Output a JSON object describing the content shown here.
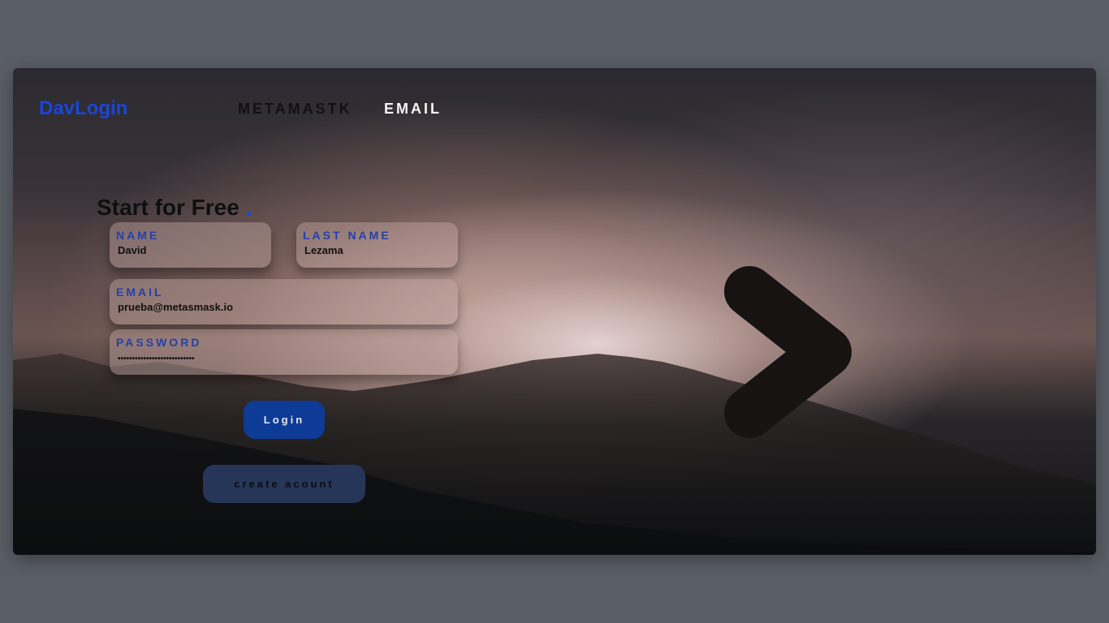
{
  "nav": {
    "brand": "DavLogin",
    "links": [
      {
        "label": "METAMASTK"
      },
      {
        "label": "EMAIL"
      }
    ]
  },
  "form": {
    "heading": "Start for Free",
    "heading_dot": ".",
    "name": {
      "label": "NAME",
      "value": "David"
    },
    "last_name": {
      "label": "LAST NAME",
      "value": "Lezama"
    },
    "email": {
      "label": "EMAIL",
      "value": "prueba@metasmask.io"
    },
    "password": {
      "label": "PASSWORD",
      "value": "•••••••••••••••••••••••••••"
    },
    "login_label": "Login",
    "create_label": "create acount"
  },
  "icons": {
    "next": "chevron-right-icon"
  },
  "colors": {
    "accent": "#1a46d6",
    "label": "#2540a8",
    "login_button": "#0d3b96",
    "create_button": "#263659",
    "page_background": "#5a5e66"
  }
}
